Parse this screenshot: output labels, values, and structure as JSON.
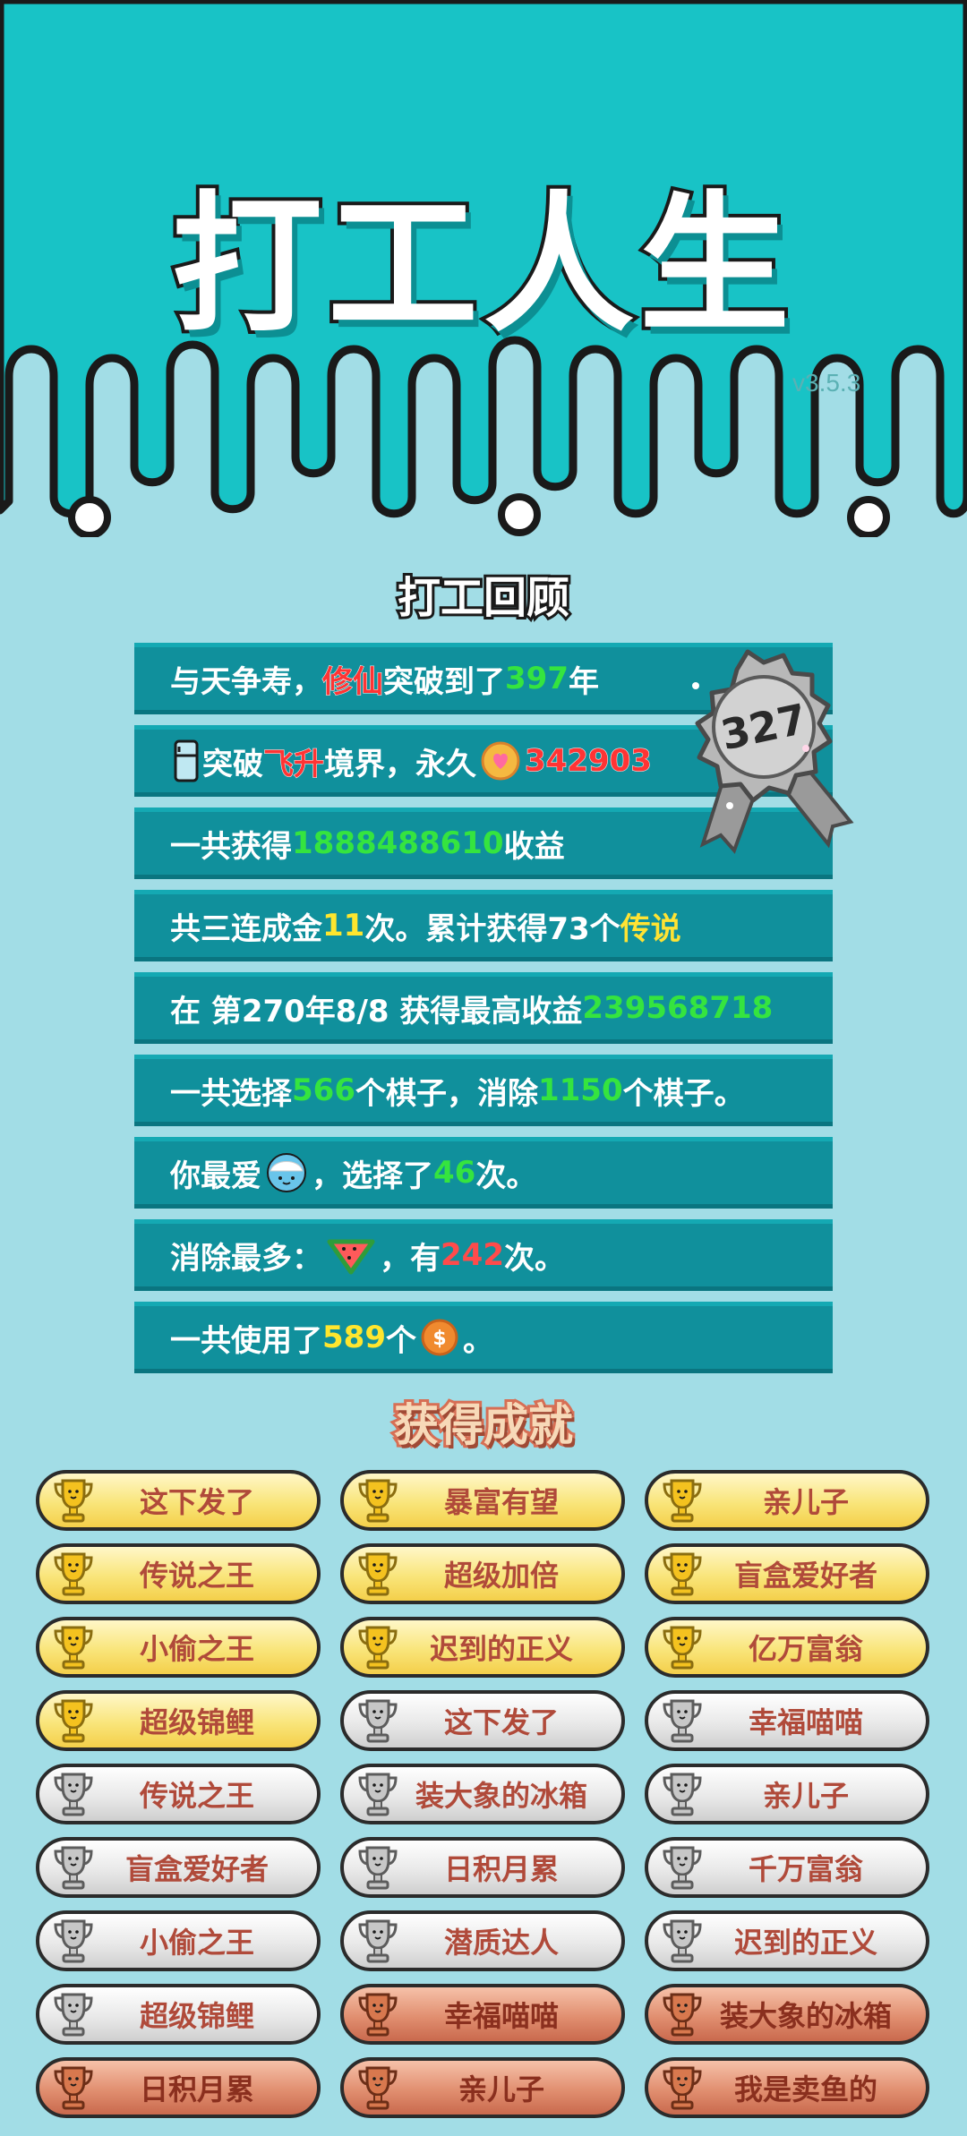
{
  "header": {
    "title": "打工人生",
    "version": "v3.5.3"
  },
  "review": {
    "title": "打工回顾",
    "medal_value": "327",
    "rows": [
      {
        "p1": "与天争寿，",
        "hl": "修仙",
        "p2": "突破到了",
        "num": "397",
        "p3": "年"
      },
      {
        "p1": "突破",
        "hl": "飞升",
        "p2": "境界，永久",
        "num": "342903"
      },
      {
        "p1": "一共获得",
        "num": "1888488610",
        "p2": "收益"
      },
      {
        "p1": "共三连成金",
        "num": "11",
        "p2": "次。累计获得73个",
        "hl": "传说"
      },
      {
        "p1": "在 第270年8/8 获得最高收益",
        "num": "239568718"
      },
      {
        "p1": "一共选择",
        "num": "566",
        "p2": "个棋子，消除",
        "num2": "1150",
        "p3": "个棋子。"
      },
      {
        "p1": "你最爱",
        "p2": "，选择了",
        "num": "46",
        "p3": "次。"
      },
      {
        "p1": "消除最多：",
        "p2": "，有",
        "num": "242",
        "p3": "次。"
      },
      {
        "p1": "一共使用了",
        "num": "589",
        "p2": "个",
        "p3": "。"
      }
    ]
  },
  "achievements": {
    "title": "获得成就",
    "items": [
      {
        "label": "这下发了",
        "tier": "gold"
      },
      {
        "label": "暴富有望",
        "tier": "gold"
      },
      {
        "label": "亲儿子",
        "tier": "gold"
      },
      {
        "label": "传说之王",
        "tier": "gold"
      },
      {
        "label": "超级加倍",
        "tier": "gold"
      },
      {
        "label": "盲盒爱好者",
        "tier": "gold"
      },
      {
        "label": "小偷之王",
        "tier": "gold"
      },
      {
        "label": "迟到的正义",
        "tier": "gold"
      },
      {
        "label": "亿万富翁",
        "tier": "gold"
      },
      {
        "label": "超级锦鲤",
        "tier": "gold"
      },
      {
        "label": "这下发了",
        "tier": "silver"
      },
      {
        "label": "幸福喵喵",
        "tier": "silver"
      },
      {
        "label": "传说之王",
        "tier": "silver"
      },
      {
        "label": "装大象的冰箱",
        "tier": "silver"
      },
      {
        "label": "亲儿子",
        "tier": "silver"
      },
      {
        "label": "盲盒爱好者",
        "tier": "silver"
      },
      {
        "label": "日积月累",
        "tier": "silver"
      },
      {
        "label": "千万富翁",
        "tier": "silver"
      },
      {
        "label": "小偷之王",
        "tier": "silver"
      },
      {
        "label": "潜质达人",
        "tier": "silver"
      },
      {
        "label": "迟到的正义",
        "tier": "silver"
      },
      {
        "label": "超级锦鲤",
        "tier": "silver"
      },
      {
        "label": "幸福喵喵",
        "tier": "bronze"
      },
      {
        "label": "装大象的冰箱",
        "tier": "bronze"
      },
      {
        "label": "日积月累",
        "tier": "bronze"
      },
      {
        "label": "亲儿子",
        "tier": "bronze"
      },
      {
        "label": "我是卖鱼的",
        "tier": "bronze"
      }
    ]
  },
  "colors": {
    "header_bg": "#18c3c6",
    "page_bg": "#a2dde6",
    "row_bg": "#10909c",
    "number_green": "#35e43f",
    "number_yellow": "#ffe62e",
    "number_red": "#ff4b4b"
  },
  "icons": {
    "row2_lead": "fridge-icon",
    "row2_trail": "heart-coin-icon",
    "row7": "rice-bowl-icon",
    "row8": "watermelon-icon",
    "row9": "dollar-coin-icon",
    "achievement": "trophy-icon"
  }
}
